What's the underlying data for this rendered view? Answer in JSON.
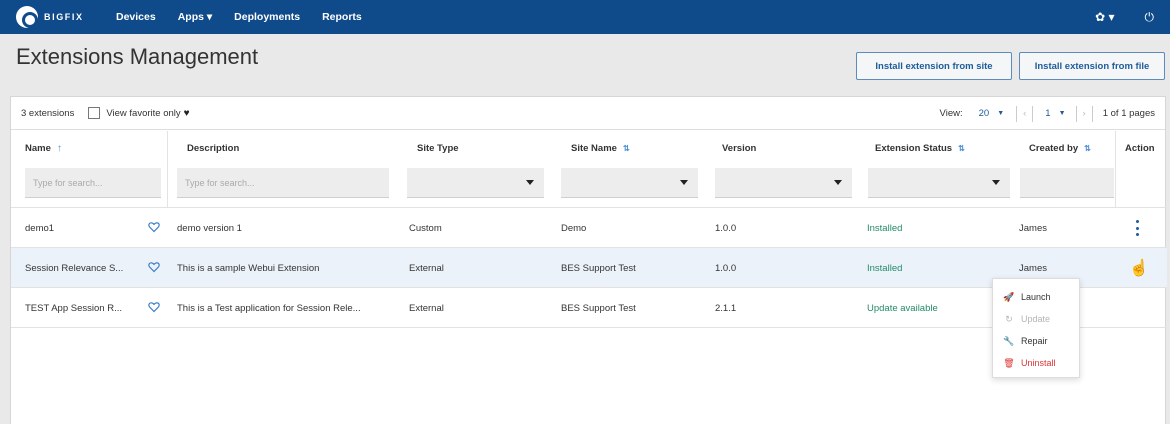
{
  "nav": {
    "brand": "BIGFIX",
    "items": [
      "Devices",
      "Apps ▾",
      "Deployments",
      "Reports"
    ],
    "settings": "✿ ▾",
    "power": "⏻"
  },
  "page": {
    "title": "Extensions Management",
    "install_site_btn": "Install extension from site",
    "install_file_btn": "Install extension from file"
  },
  "toolbar": {
    "count": "3 extensions",
    "fav_label": "View favorite only",
    "view_label": "View:",
    "page_size": "20",
    "page_num": "1",
    "page_info": "1 of 1 pages"
  },
  "columns": [
    "Name",
    "Description",
    "Site Type",
    "Site Name",
    "Version",
    "Extension Status",
    "Created by",
    "Action"
  ],
  "filters": {
    "name_placeholder": "Type for search...",
    "desc_placeholder": "Type for search..."
  },
  "rows": [
    {
      "name": "demo1",
      "description": "demo version 1",
      "site_type": "Custom",
      "site_name": "Demo",
      "version": "1.0.0",
      "status": "Installed",
      "created_by": "James"
    },
    {
      "name": "Session Relevance S...",
      "description": "This is a sample Webui Extension",
      "site_type": "External",
      "site_name": "BES Support Test",
      "version": "1.0.0",
      "status": "Installed",
      "created_by": "James"
    },
    {
      "name": "TEST App Session R...",
      "description": "This is a Test application for Session Rele...",
      "site_type": "External",
      "site_name": "BES Support Test",
      "version": "2.1.1",
      "status": "Update available",
      "created_by": ""
    }
  ],
  "action_menu": [
    "Launch",
    "Update",
    "Repair",
    "Uninstall"
  ],
  "colors": {
    "nav": "#0f4a8a",
    "accent": "#1f5c99",
    "installed": "#238a6a",
    "danger": "#dd3333"
  }
}
